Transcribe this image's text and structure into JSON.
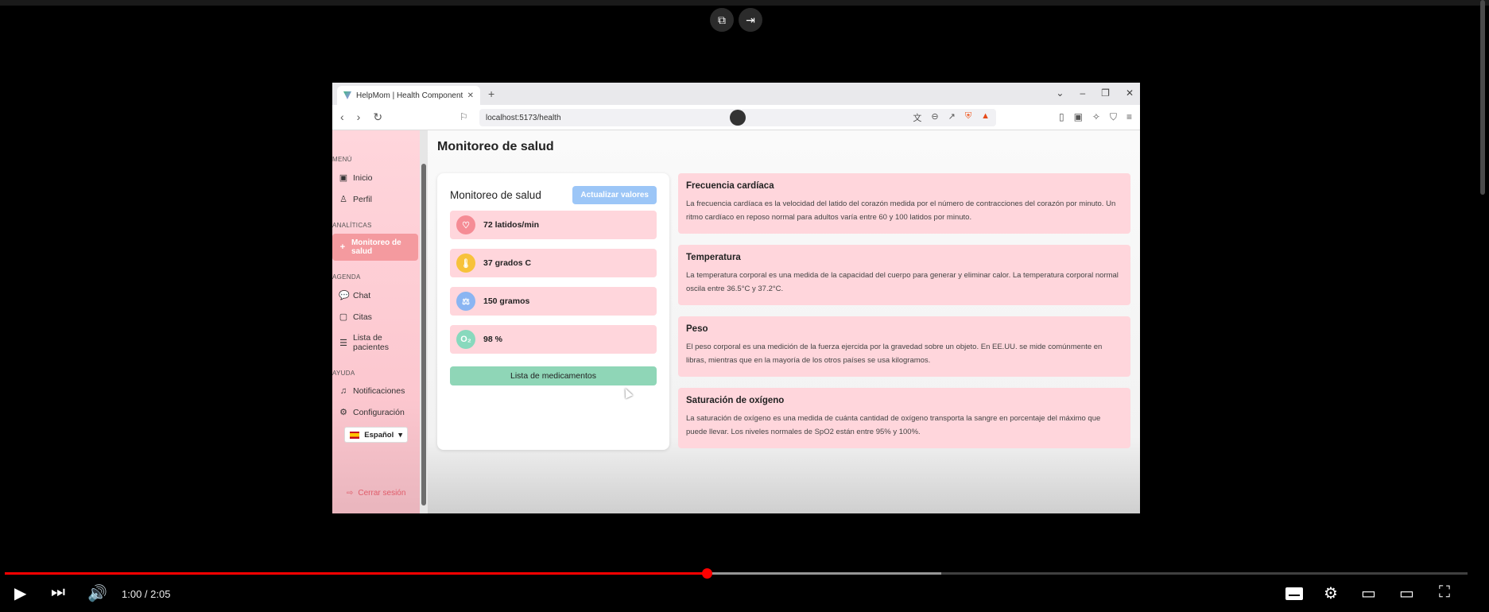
{
  "browser": {
    "tab_title": "HelpMom | Health Component",
    "new_tab": "+",
    "close_tab": "✕",
    "url": "localhost:5173/health"
  },
  "sidebar": {
    "sections": {
      "menu": "MENÚ",
      "analytics": "ANALÍTICAS",
      "agenda": "AGENDA",
      "help": "AYUDA"
    },
    "items": {
      "inicio": "Inicio",
      "perfil": "Perfil",
      "monitoreo": "Monitoreo de salud",
      "chat": "Chat",
      "citas": "Citas",
      "pacientes": "Lista de pacientes",
      "notificaciones": "Notificaciones",
      "configuracion": "Configuración"
    },
    "language": "Español",
    "logout": "Cerrar sesión"
  },
  "main": {
    "page_title": "Monitoreo de salud",
    "card": {
      "title": "Monitoreo de salud",
      "update_button": "Actualizar valores",
      "metrics": {
        "heart": "72 latidos/min",
        "temp": "37 grados C",
        "weight": "150 gramos",
        "oxygen": "98 %"
      },
      "med_button": "Lista de medicamentos"
    },
    "info": {
      "heart": {
        "title": "Frecuencia cardíaca",
        "text": "La frecuencia cardíaca es la velocidad del latido del corazón medida por el número de contracciones del corazón por minuto. Un ritmo cardíaco en reposo normal para adultos varía entre 60 y 100 latidos por minuto."
      },
      "temp": {
        "title": "Temperatura",
        "text": "La temperatura corporal es una medida de la capacidad del cuerpo para generar y eliminar calor. La temperatura corporal normal oscila entre 36.5°C y 37.2°C."
      },
      "weight": {
        "title": "Peso",
        "text": "El peso corporal es una medición de la fuerza ejercida por la gravedad sobre un objeto. En EE.UU. se mide comúnmente en libras, mientras que en la mayoría de los otros países se usa kilogramos."
      },
      "oxygen": {
        "title": "Saturación de oxígeno",
        "text": "La saturación de oxígeno es una medida de cuánta cantidad de oxígeno transporta la sangre en porcentaje del máximo que puede llevar. Los niveles normales de SpO2 están entre 95% y 100%."
      }
    }
  },
  "player": {
    "time": "1:00 / 2:05",
    "progress_fraction": 0.48,
    "buffered_fraction": 0.64
  },
  "colors": {
    "sidebar": "#ffd6dc",
    "active_item": "#f49a9f",
    "update_button": "#9cc6f7",
    "med_button": "#8fd6b7",
    "progress_red": "#ff0000"
  }
}
